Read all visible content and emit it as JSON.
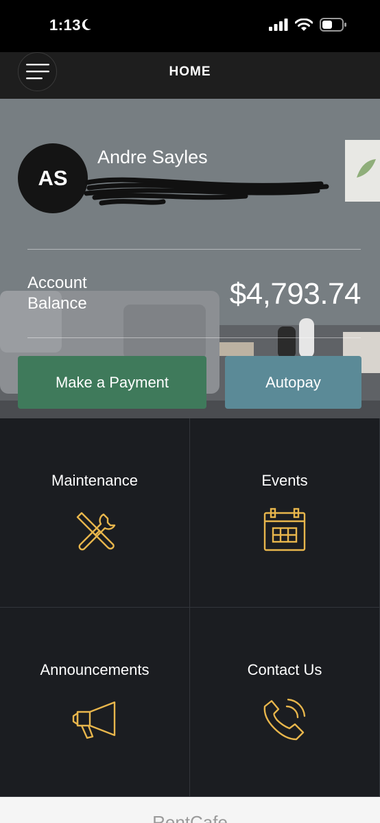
{
  "status_bar": {
    "time": "1:13"
  },
  "nav": {
    "title": "HOME"
  },
  "user": {
    "initials": "AS",
    "name": "Andre Sayles"
  },
  "balance": {
    "label": "Account Balance",
    "value": "$4,793.74"
  },
  "actions": {
    "pay_label": "Make a Payment",
    "autopay_label": "Autopay"
  },
  "tiles": [
    {
      "label": "Maintenance",
      "icon": "wrench-screwdriver-icon"
    },
    {
      "label": "Events",
      "icon": "calendar-icon"
    },
    {
      "label": "Announcements",
      "icon": "megaphone-icon"
    },
    {
      "label": "Contact Us",
      "icon": "phone-icon"
    }
  ],
  "footer": {
    "brand": "RentCafe"
  },
  "colors": {
    "accent_icon": "#e8b64c",
    "pay_button": "#3f7a5b",
    "autopay_button": "#5b8a97"
  }
}
